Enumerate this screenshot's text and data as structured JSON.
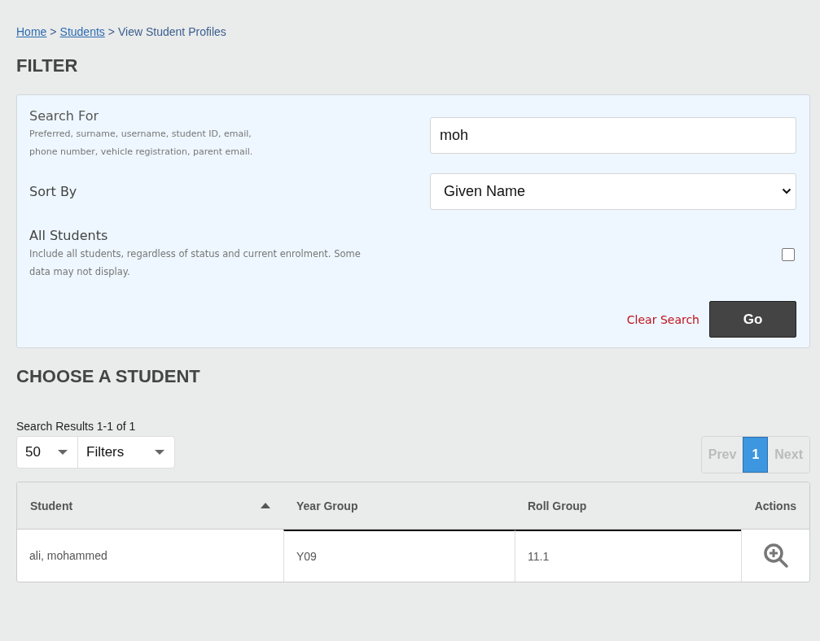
{
  "breadcrumb": {
    "separator": ">",
    "items": [
      {
        "label": "Home",
        "kind": "link"
      },
      {
        "label": "Students",
        "kind": "link"
      },
      {
        "label": "View Student Profiles",
        "kind": "current"
      }
    ]
  },
  "filter": {
    "title": "FILTER",
    "search": {
      "label": "Search For",
      "description": "Preferred, surname, username, student ID, email, phone number, vehicle registration, parent email.",
      "value": "moh"
    },
    "sort": {
      "label": "Sort By",
      "value": "Given Name"
    },
    "all_students": {
      "label": "All Students",
      "description": "Include all students, regardless of status and current enrolment. Some data may not display.",
      "checked": false
    },
    "clear_link": "Clear Search",
    "go_button": "Go"
  },
  "results": {
    "title": "CHOOSE A STUDENT",
    "summary": "Search Results 1-1 of 1",
    "page_size": "50",
    "filters": "Filters",
    "pagination": [
      {
        "label": "Prev",
        "selected": false,
        "disabled": true
      },
      {
        "label": "1",
        "selected": true,
        "disabled": false
      },
      {
        "label": "Next",
        "selected": false,
        "disabled": true
      }
    ]
  },
  "table": {
    "columns": [
      {
        "label": "Student",
        "sorted": true
      },
      {
        "label": "Year Group",
        "sorted": false
      },
      {
        "label": "Roll Group",
        "sorted": false
      },
      {
        "label": "Actions",
        "sorted": false
      }
    ],
    "rows": [
      {
        "cells": [
          "ali, mohammed",
          "Y09",
          "11.1"
        ]
      }
    ]
  }
}
